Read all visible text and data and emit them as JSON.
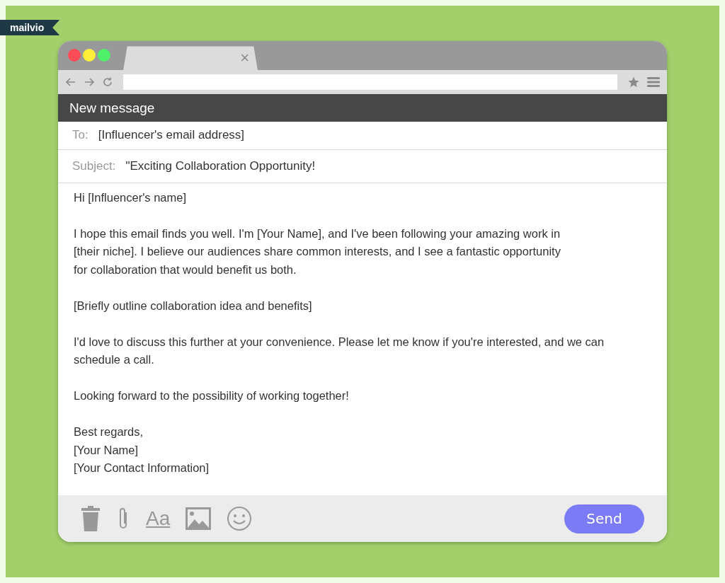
{
  "logo": "mailvio",
  "browser": {
    "tab_close": "×"
  },
  "compose": {
    "title": "New message",
    "to": {
      "label": "To:",
      "value": "[Influencer's email address]"
    },
    "subject": {
      "label": "Subject:",
      "value": "\"Exciting Collaboration Opportunity!"
    },
    "body": [
      [
        "Hi [Influencer's name]"
      ],
      [
        "I hope this email finds you well. I'm [Your Name], and I've been following your amazing work in",
        "[their niche]. I believe our audiences share common interests, and I see a fantastic opportunity",
        "for collaboration that would benefit us both."
      ],
      [
        "[Briefly outline collaboration idea and benefits]"
      ],
      [
        "I'd love to discuss this further at your convenience. Please let me know if you're interested, and we can",
        "schedule a call."
      ],
      [
        "Looking forward to the possibility of working together!"
      ],
      [
        "Best regards,",
        "[Your Name]",
        "[Your Contact Information]"
      ]
    ],
    "format_label": "Aa",
    "send": "Send"
  }
}
